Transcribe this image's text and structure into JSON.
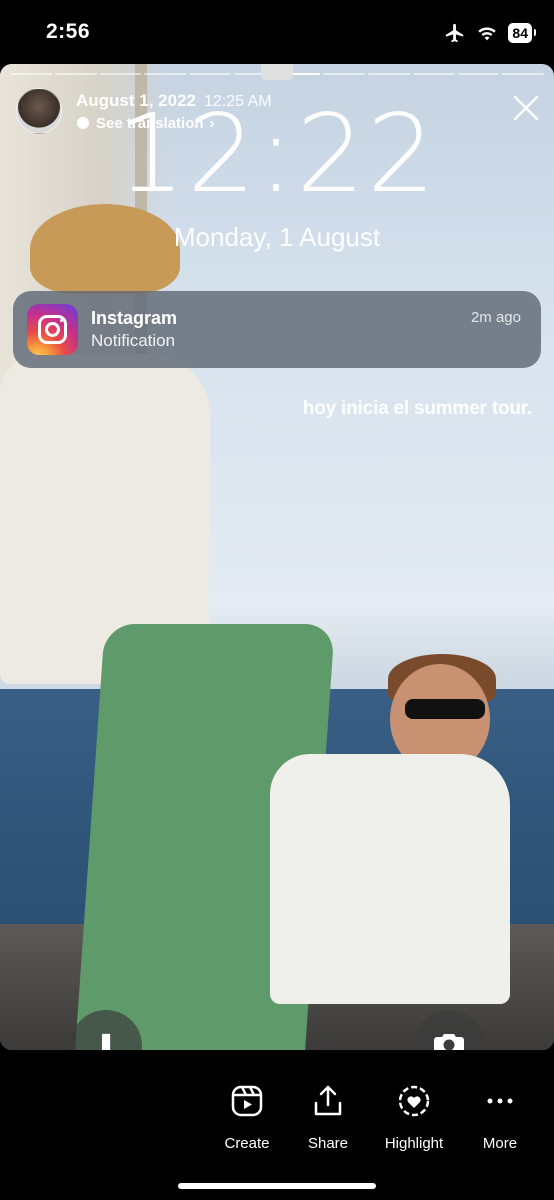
{
  "status_bar": {
    "time": "2:56",
    "battery": "84"
  },
  "story": {
    "date": "August 1, 2022",
    "time": "12:25 AM",
    "translate_label": "See translation",
    "progress_segments": 12,
    "progress_active": 6
  },
  "lockscreen": {
    "clock": "12:22",
    "date": "Monday, 1 August"
  },
  "notification": {
    "app": "Instagram",
    "body": "Notification",
    "ago": "2m ago"
  },
  "caption": "hoy inicia el summer tour.",
  "actions": [
    {
      "label": "Create",
      "icon": "reels-icon"
    },
    {
      "label": "Share",
      "icon": "share-icon"
    },
    {
      "label": "Highlight",
      "icon": "highlight-icon"
    },
    {
      "label": "More",
      "icon": "more-icon"
    }
  ]
}
